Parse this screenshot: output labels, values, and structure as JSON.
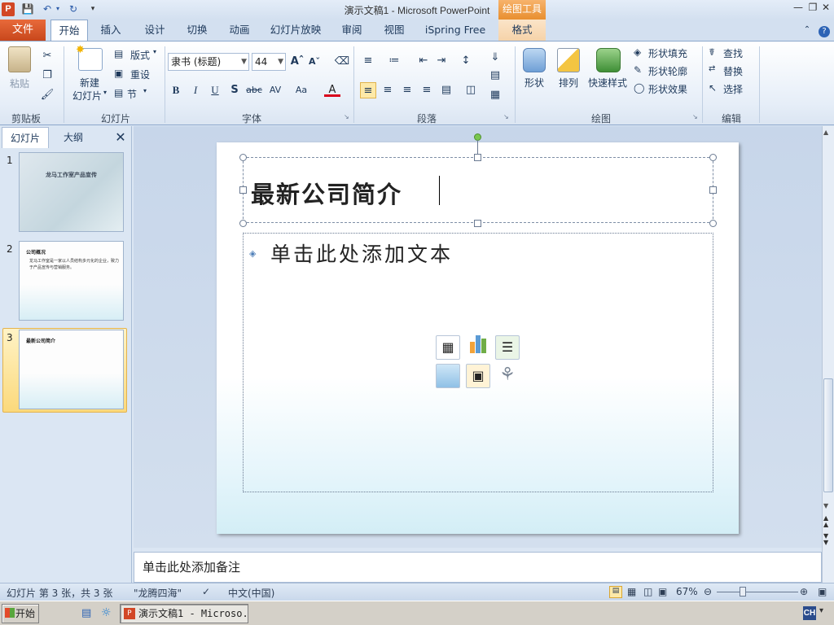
{
  "window": {
    "title": "演示文稿1 - Microsoft PowerPoint",
    "app_logo": "P",
    "contextual_tab_group": "绘图工具"
  },
  "tabs": {
    "file": "文件",
    "home": "开始",
    "insert": "插入",
    "design": "设计",
    "transitions": "切换",
    "animations": "动画",
    "slideshow": "幻灯片放映",
    "review": "审阅",
    "view": "视图",
    "ispring": "iSpring Free",
    "format": "格式"
  },
  "ribbon": {
    "clipboard": {
      "paste": "粘贴",
      "label": "剪贴板"
    },
    "slides": {
      "new_slide_1": "新建",
      "new_slide_2": "幻灯片",
      "layout": "版式",
      "reset": "重设",
      "section": "节",
      "label": "幻灯片"
    },
    "font": {
      "font_name": "隶书 (标题)",
      "font_size": "44",
      "label": "字体"
    },
    "paragraph": {
      "label": "段落"
    },
    "drawing": {
      "shapes": "形状",
      "arrange": "排列",
      "quick_styles": "快速样式",
      "shape_fill": "形状填充",
      "shape_outline": "形状轮廓",
      "shape_effects": "形状效果",
      "label": "绘图"
    },
    "editing": {
      "find": "查找",
      "replace": "替换",
      "select": "选择",
      "label": "编辑"
    }
  },
  "panel": {
    "tab_slides": "幻灯片",
    "tab_outline": "大纲",
    "thumbnails": [
      {
        "num": "1",
        "title": "龙马工作室产品宣传"
      },
      {
        "num": "2",
        "title": "公司概况",
        "body": "龙马工作室是一家以人员结构多元化的企业，致力于产品宣传与营销服务。"
      },
      {
        "num": "3",
        "title": "最新公司简介"
      }
    ]
  },
  "slide": {
    "title": "最新公司简介",
    "content_placeholder": "单击此处添加文本"
  },
  "notes": {
    "placeholder": "单击此处添加备注"
  },
  "status": {
    "slide_info": "幻灯片 第 3 张，共 3 张",
    "theme": "\"龙腾四海\"",
    "language": "中文(中国)",
    "zoom": "67%"
  },
  "taskbar": {
    "start": "开始",
    "task_item": "演示文稿1 - Microso...",
    "ime": "CH"
  },
  "colors": {
    "file_tab": "#c8471c",
    "context_tab": "#e88f2f",
    "selected_thumb": "#fbd97b"
  }
}
